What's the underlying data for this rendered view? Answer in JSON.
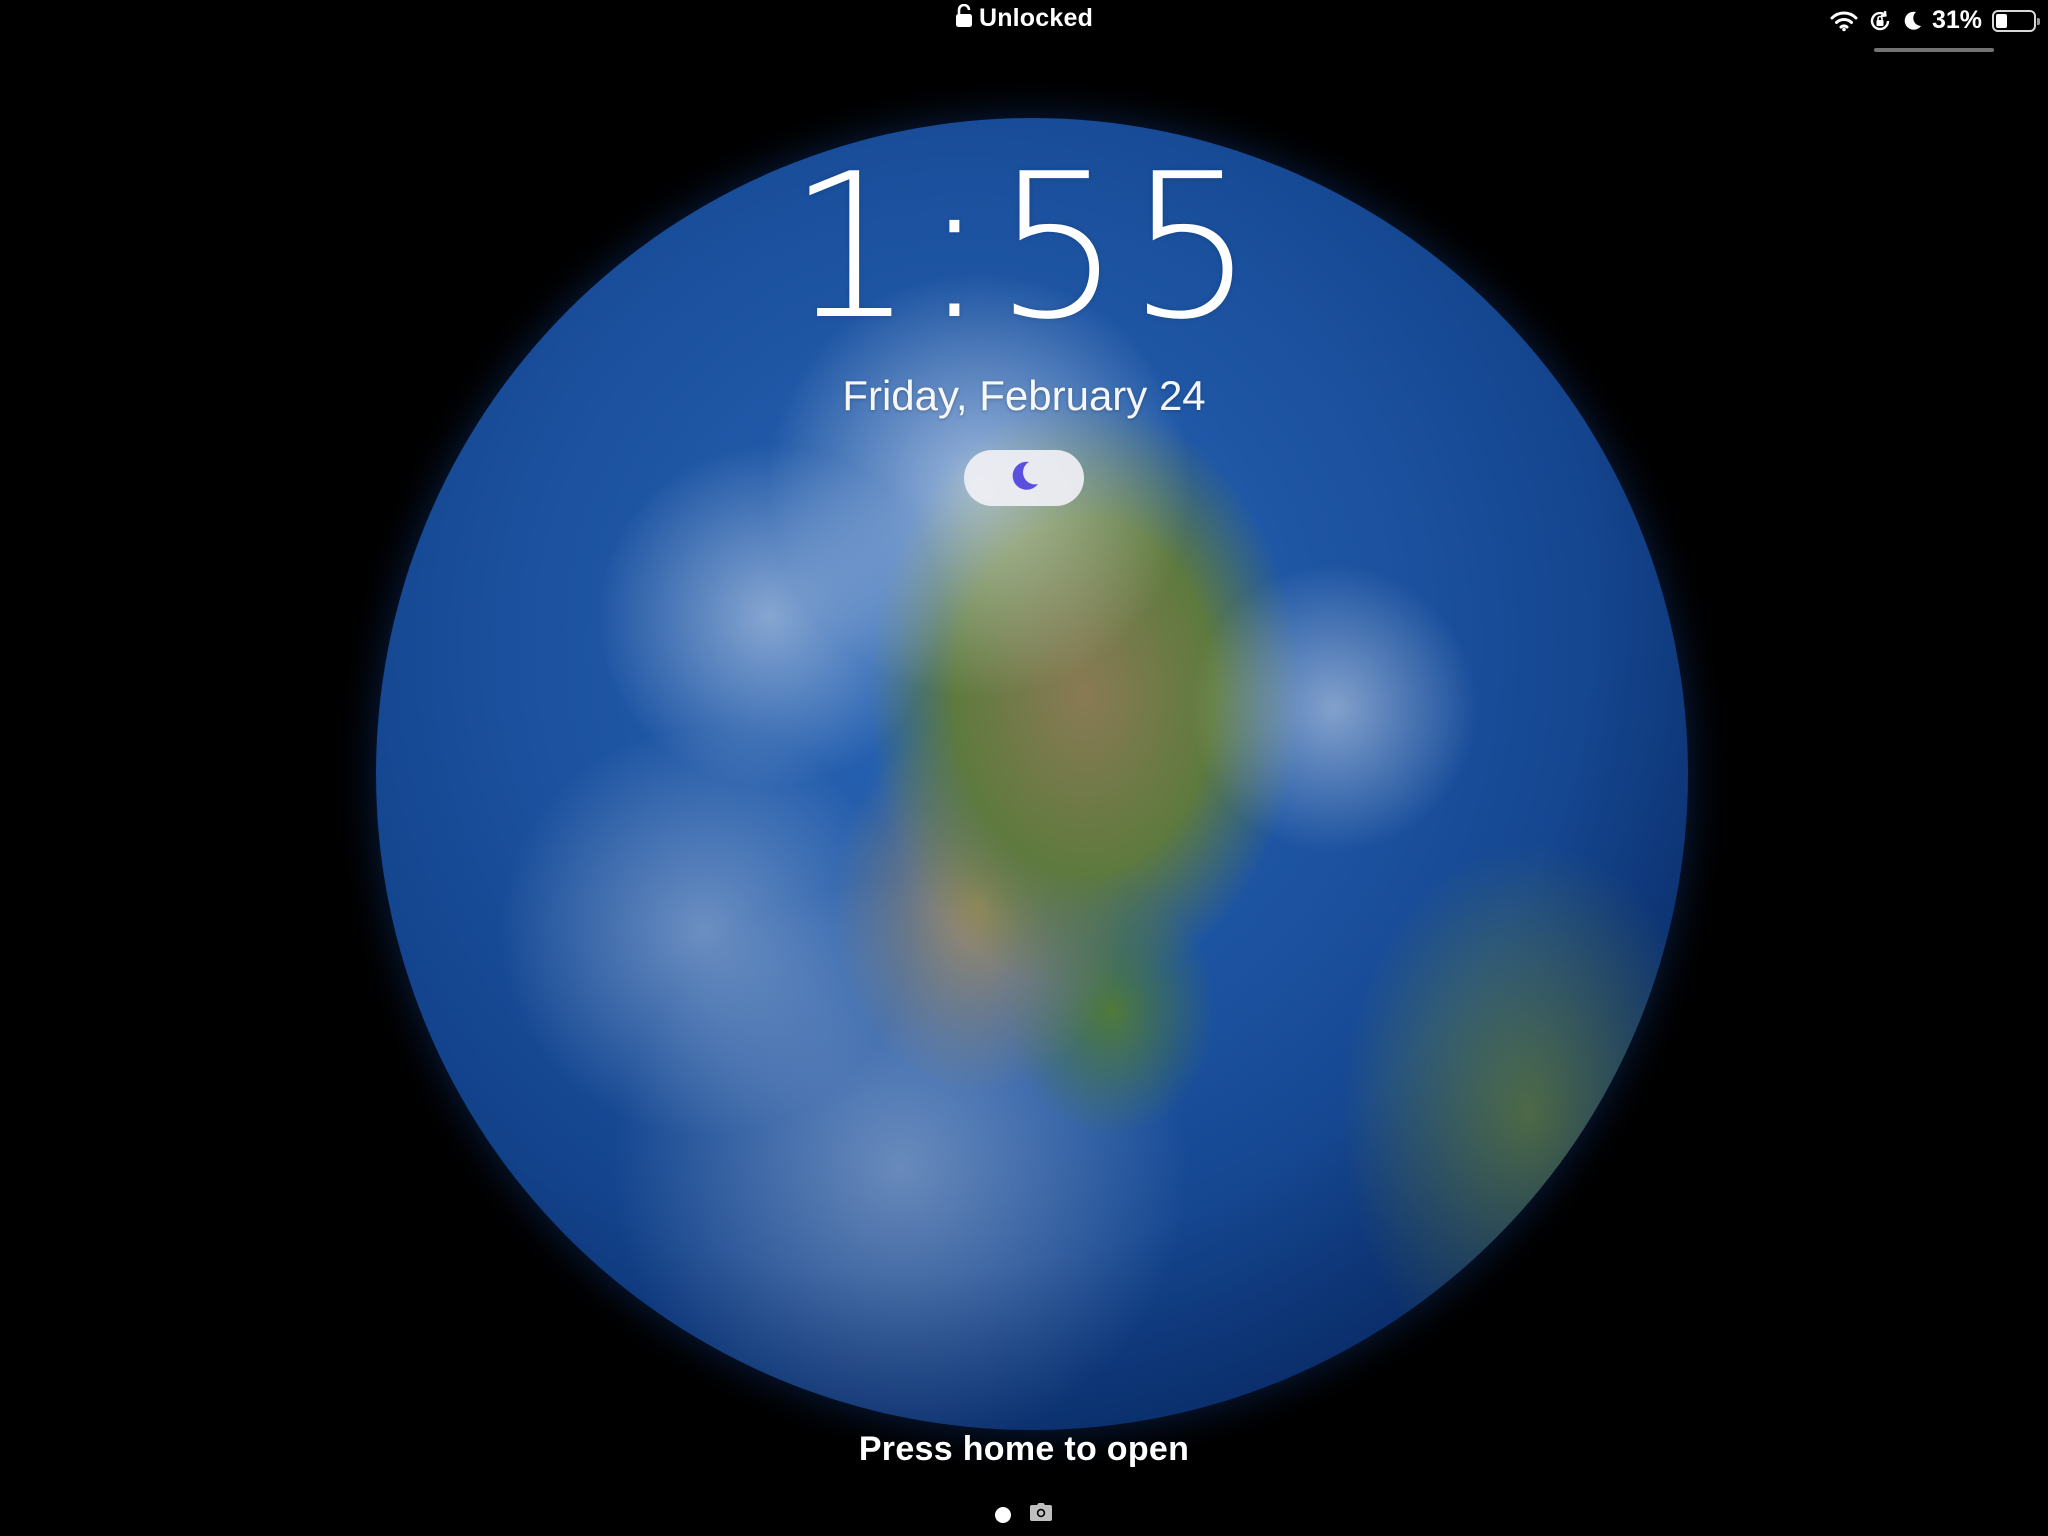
{
  "status_bar": {
    "lock_status": "Unlocked",
    "lock_icon": "lock-open-icon",
    "battery_percent_text": "31%",
    "battery_level": 0.31,
    "icons": [
      "wifi-icon",
      "orientation-lock-icon",
      "moon-icon",
      "battery-icon"
    ]
  },
  "lock_screen": {
    "time": "1:55",
    "date": "Friday, February 24",
    "focus_icon": "moon-icon",
    "focus_color": "#5b4fe0",
    "unlock_hint": "Press home to open"
  },
  "page_indicator": {
    "items": [
      "page-dot",
      "camera-icon"
    ]
  },
  "wallpaper": "earth"
}
